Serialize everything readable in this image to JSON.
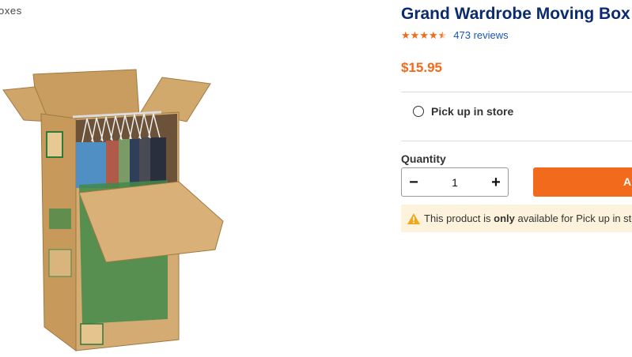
{
  "breadcrumb": "oxes",
  "product": {
    "title": "Grand Wardrobe Moving Box",
    "rating": {
      "stars": 4.5,
      "reviews": "473 reviews"
    },
    "price": "$15.95",
    "image_icon": "wardrobe-box-image"
  },
  "fulfillment": {
    "pickup_label": "Pick up in store",
    "pickup_selected": false
  },
  "quantity": {
    "label": "Quantity",
    "value": "1",
    "decrement": "−",
    "increment": "+"
  },
  "add_button": {
    "label": "A"
  },
  "notice": {
    "before": "This product is ",
    "emphasis": "only",
    "after": " available for Pick up in sto",
    "icon": "warning-icon"
  },
  "colors": {
    "title": "#0b2a6f",
    "accent": "#f26a1b",
    "link": "#1a56b8",
    "notice_bg": "#fdf3dc"
  }
}
